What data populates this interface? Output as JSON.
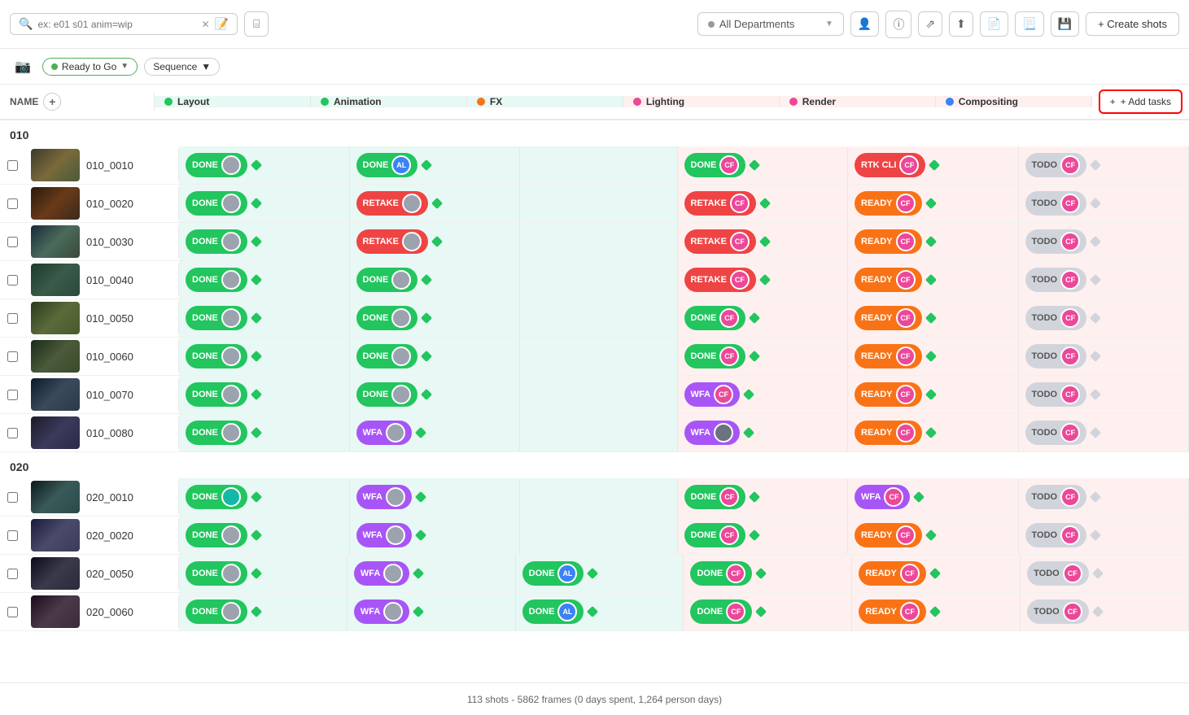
{
  "toolbar": {
    "search_placeholder": "ex: e01 s01 anim=wip",
    "filter_label": "Filter",
    "dept_label": "All Departments",
    "create_shots_label": "+ Create shots"
  },
  "filter_bar": {
    "ready_label": "Ready to Go",
    "sequence_label": "Sequence"
  },
  "table": {
    "name_col": "NAME",
    "add_col_label": "+",
    "add_tasks_label": "+ Add tasks",
    "columns": [
      {
        "id": "layout",
        "label": "Layout",
        "color": "#22c55e"
      },
      {
        "id": "animation",
        "label": "Animation",
        "color": "#22c55e"
      },
      {
        "id": "fx",
        "label": "FX",
        "color": "#f97316"
      },
      {
        "id": "lighting",
        "label": "Lighting",
        "color": "#ec4899"
      },
      {
        "id": "render",
        "label": "Render",
        "color": "#ec4899"
      },
      {
        "id": "compositing",
        "label": "Compositing",
        "color": "#3b82f6"
      }
    ]
  },
  "groups": [
    {
      "name": "010",
      "rows": [
        {
          "id": "010_0010",
          "layout": {
            "status": "DONE",
            "avatar_color": "#9ca3af",
            "avatar_initials": ""
          },
          "animation": {
            "status": "DONE",
            "avatar_color": "#3b82f6",
            "avatar_initials": "AL"
          },
          "fx": null,
          "lighting": {
            "status": "DONE",
            "avatar_color": "#ec4899",
            "avatar_initials": "CF"
          },
          "render": {
            "status": "RTK CLI",
            "avatar_color": "#ec4899",
            "avatar_initials": "CF"
          },
          "compositing": {
            "status": "TODO",
            "avatar_color": "#ec4899",
            "avatar_initials": "CF"
          }
        },
        {
          "id": "010_0020",
          "layout": {
            "status": "DONE",
            "avatar_color": "#9ca3af",
            "avatar_initials": ""
          },
          "animation": {
            "status": "RETAKE",
            "avatar_color": "#9ca3af",
            "avatar_initials": ""
          },
          "fx": null,
          "lighting": {
            "status": "RETAKE",
            "avatar_color": "#ec4899",
            "avatar_initials": "CF"
          },
          "render": {
            "status": "READY",
            "avatar_color": "#ec4899",
            "avatar_initials": "CF"
          },
          "compositing": {
            "status": "TODO",
            "avatar_color": "#ec4899",
            "avatar_initials": "CF"
          }
        },
        {
          "id": "010_0030",
          "layout": {
            "status": "DONE",
            "avatar_color": "#9ca3af",
            "avatar_initials": ""
          },
          "animation": {
            "status": "RETAKE",
            "avatar_color": "#9ca3af",
            "avatar_initials": ""
          },
          "fx": null,
          "lighting": {
            "status": "RETAKE",
            "avatar_color": "#ec4899",
            "avatar_initials": "CF"
          },
          "render": {
            "status": "READY",
            "avatar_color": "#ec4899",
            "avatar_initials": "CF"
          },
          "compositing": {
            "status": "TODO",
            "avatar_color": "#ec4899",
            "avatar_initials": "CF"
          }
        },
        {
          "id": "010_0040",
          "layout": {
            "status": "DONE",
            "avatar_color": "#9ca3af",
            "avatar_initials": ""
          },
          "animation": {
            "status": "DONE",
            "avatar_color": "#9ca3af",
            "avatar_initials": ""
          },
          "fx": null,
          "lighting": {
            "status": "RETAKE",
            "avatar_color": "#ec4899",
            "avatar_initials": "CF"
          },
          "render": {
            "status": "READY",
            "avatar_color": "#ec4899",
            "avatar_initials": "CF"
          },
          "compositing": {
            "status": "TODO",
            "avatar_color": "#ec4899",
            "avatar_initials": "CF"
          }
        },
        {
          "id": "010_0050",
          "layout": {
            "status": "DONE",
            "avatar_color": "#9ca3af",
            "avatar_initials": ""
          },
          "animation": {
            "status": "DONE",
            "avatar_color": "#9ca3af",
            "avatar_initials": ""
          },
          "fx": null,
          "lighting": {
            "status": "DONE",
            "avatar_color": "#ec4899",
            "avatar_initials": "CF"
          },
          "render": {
            "status": "READY",
            "avatar_color": "#ec4899",
            "avatar_initials": "CF"
          },
          "compositing": {
            "status": "TODO",
            "avatar_color": "#ec4899",
            "avatar_initials": "CF"
          }
        },
        {
          "id": "010_0060",
          "layout": {
            "status": "DONE",
            "avatar_color": "#9ca3af",
            "avatar_initials": ""
          },
          "animation": {
            "status": "DONE",
            "avatar_color": "#9ca3af",
            "avatar_initials": ""
          },
          "fx": null,
          "lighting": {
            "status": "DONE",
            "avatar_color": "#ec4899",
            "avatar_initials": "CF"
          },
          "render": {
            "status": "READY",
            "avatar_color": "#ec4899",
            "avatar_initials": "CF"
          },
          "compositing": {
            "status": "TODO",
            "avatar_color": "#ec4899",
            "avatar_initials": "CF"
          }
        },
        {
          "id": "010_0070",
          "layout": {
            "status": "DONE",
            "avatar_color": "#9ca3af",
            "avatar_initials": ""
          },
          "animation": {
            "status": "DONE",
            "avatar_color": "#9ca3af",
            "avatar_initials": ""
          },
          "fx": null,
          "lighting": {
            "status": "WFA",
            "avatar_color": "#ec4899",
            "avatar_initials": "CF"
          },
          "render": {
            "status": "READY",
            "avatar_color": "#ec4899",
            "avatar_initials": "CF"
          },
          "compositing": {
            "status": "TODO",
            "avatar_color": "#ec4899",
            "avatar_initials": "CF"
          }
        },
        {
          "id": "010_0080",
          "layout": {
            "status": "DONE",
            "avatar_color": "#9ca3af",
            "avatar_initials": ""
          },
          "animation": {
            "status": "WFA",
            "avatar_color": "#9ca3af",
            "avatar_initials": ""
          },
          "fx": null,
          "lighting": {
            "status": "WFA",
            "avatar_color": "#6b7280",
            "avatar_initials": ""
          },
          "render": {
            "status": "READY",
            "avatar_color": "#ec4899",
            "avatar_initials": "CF"
          },
          "compositing": {
            "status": "TODO",
            "avatar_color": "#ec4899",
            "avatar_initials": "CF"
          }
        }
      ]
    },
    {
      "name": "020",
      "rows": [
        {
          "id": "020_0010",
          "layout": {
            "status": "DONE",
            "avatar_color": "#14b8a6",
            "avatar_initials": ""
          },
          "animation": {
            "status": "WFA",
            "avatar_color": "#9ca3af",
            "avatar_initials": ""
          },
          "fx": null,
          "lighting": {
            "status": "DONE",
            "avatar_color": "#ec4899",
            "avatar_initials": "CF"
          },
          "render": {
            "status": "WFA",
            "avatar_color": "#ec4899",
            "avatar_initials": "CF"
          },
          "compositing": {
            "status": "TODO",
            "avatar_color": "#ec4899",
            "avatar_initials": "CF"
          }
        },
        {
          "id": "020_0020",
          "layout": {
            "status": "DONE",
            "avatar_color": "#9ca3af",
            "avatar_initials": ""
          },
          "animation": {
            "status": "WFA",
            "avatar_color": "#9ca3af",
            "avatar_initials": ""
          },
          "fx": null,
          "lighting": {
            "status": "DONE",
            "avatar_color": "#ec4899",
            "avatar_initials": "CF"
          },
          "render": {
            "status": "READY",
            "avatar_color": "#ec4899",
            "avatar_initials": "CF"
          },
          "compositing": {
            "status": "TODO",
            "avatar_color": "#ec4899",
            "avatar_initials": "CF"
          }
        },
        {
          "id": "020_0050",
          "layout": {
            "status": "DONE",
            "avatar_color": "#9ca3af",
            "avatar_initials": ""
          },
          "animation": {
            "status": "WFA",
            "avatar_color": "#9ca3af",
            "avatar_initials": ""
          },
          "fx": {
            "status": "DONE",
            "avatar_color": "#3b82f6",
            "avatar_initials": "AL"
          },
          "lighting": {
            "status": "DONE",
            "avatar_color": "#ec4899",
            "avatar_initials": "CF"
          },
          "render": {
            "status": "READY",
            "avatar_color": "#ec4899",
            "avatar_initials": "CF"
          },
          "compositing": {
            "status": "TODO",
            "avatar_color": "#ec4899",
            "avatar_initials": "CF"
          }
        },
        {
          "id": "020_0060",
          "layout": {
            "status": "DONE",
            "avatar_color": "#9ca3af",
            "avatar_initials": ""
          },
          "animation": {
            "status": "WFA",
            "avatar_color": "#9ca3af",
            "avatar_initials": ""
          },
          "fx": {
            "status": "DONE",
            "avatar_color": "#3b82f6",
            "avatar_initials": "AL"
          },
          "lighting": {
            "status": "DONE",
            "avatar_color": "#ec4899",
            "avatar_initials": "CF"
          },
          "render": {
            "status": "READY",
            "avatar_color": "#ec4899",
            "avatar_initials": "CF"
          },
          "compositing": {
            "status": "TODO",
            "avatar_color": "#ec4899",
            "avatar_initials": "CF"
          }
        }
      ]
    }
  ],
  "status_bar": {
    "text": "113 shots - 5862 frames (0 days spent, 1,264 person days)"
  }
}
